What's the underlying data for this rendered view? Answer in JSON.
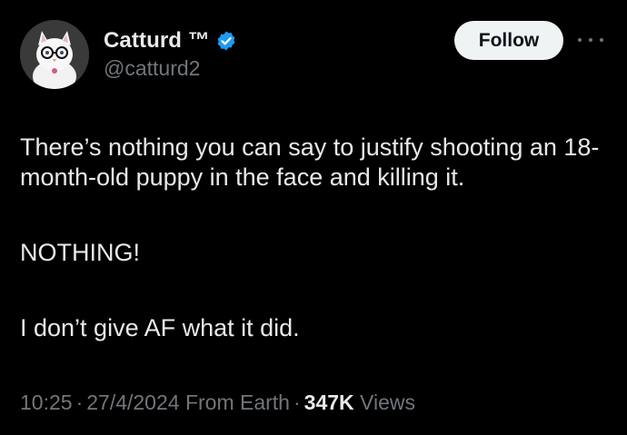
{
  "author": {
    "display_name": "Catturd ™",
    "handle": "@catturd2",
    "verified": true,
    "verified_color": "#1d9bf0",
    "avatar_icon": "white-cat-with-glasses-avatar"
  },
  "actions": {
    "follow_label": "Follow",
    "more_icon": "ellipsis-horizontal-icon"
  },
  "tweet": {
    "paragraphs": [
      "There’s nothing you can say to justify shooting an 18-month-old puppy in the face and killing it.",
      "NOTHING!",
      "I don’t give AF what it did."
    ]
  },
  "meta": {
    "time": "10:25",
    "date": "27/4/2024",
    "source": "From Earth",
    "separator": "·",
    "views_count": "347K",
    "views_label": "Views"
  },
  "colors": {
    "background": "#000000",
    "primary_text": "#e7e9ea",
    "secondary_text": "#71767b",
    "follow_bg": "#eff3f4",
    "follow_text": "#0f1419"
  }
}
